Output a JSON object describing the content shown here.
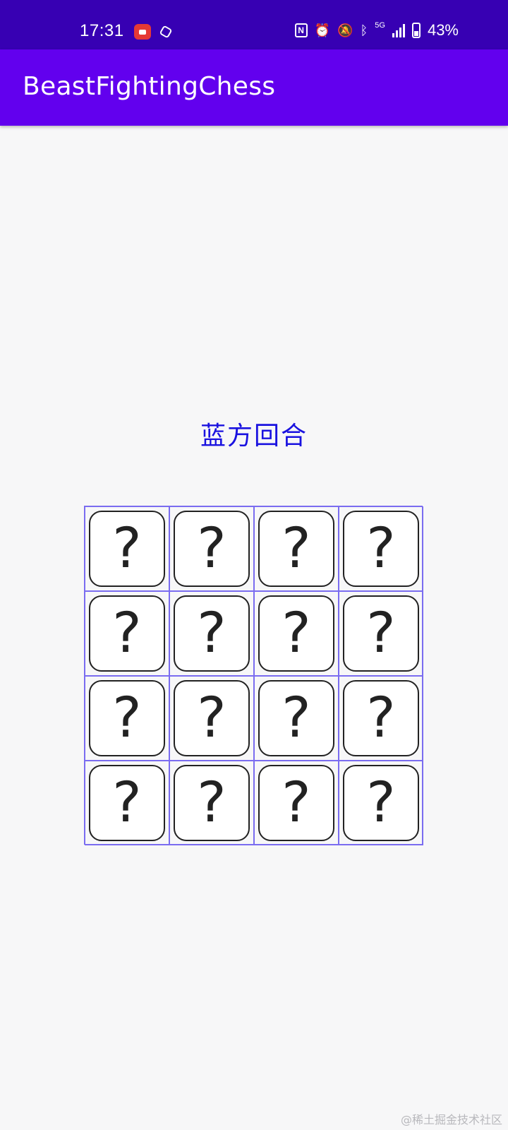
{
  "status_bar": {
    "time": "17:31",
    "battery_percent": "43%",
    "network_label": "5G",
    "icons": [
      "screen-record-icon",
      "hexagon-icon",
      "nfc-icon",
      "alarm-icon",
      "mute-icon",
      "bluetooth-icon",
      "signal-icon",
      "battery-icon"
    ]
  },
  "app_bar": {
    "title": "BeastFightingChess",
    "color": "#6200ee"
  },
  "game": {
    "turn_text": "蓝方回合",
    "turn_color": "#1a12e0",
    "tiles": [
      [
        "?",
        "?",
        "?",
        "?"
      ],
      [
        "?",
        "?",
        "?",
        "?"
      ],
      [
        "?",
        "?",
        "?",
        "?"
      ],
      [
        "?",
        "?",
        "?",
        "?"
      ]
    ]
  },
  "watermark": "@稀土掘金技术社区"
}
